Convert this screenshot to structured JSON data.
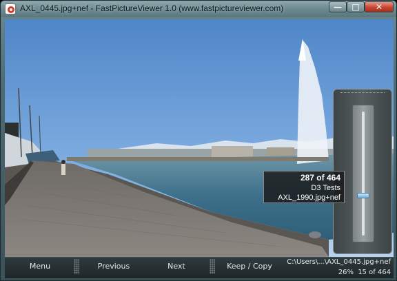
{
  "window": {
    "title": "AXL_0445.jpg+nef - FastPictureViewer 1.0 (www.fastpictureviewer.com)",
    "controls": {
      "minimize": "—",
      "maximize": "□",
      "close": "✕"
    }
  },
  "info": {
    "position": "287 of 464",
    "folder": "D3 Tests",
    "filename": "AXL_1990.jpg+nef"
  },
  "zoom_slider": {
    "level_fraction": 0.68
  },
  "toolbar": {
    "menu": "Menu",
    "previous": "Previous",
    "next": "Next",
    "keep_copy": "Keep / Copy"
  },
  "status": {
    "path": "C:\\Users\\...\\AXL_0445.jpg+nef",
    "zoom": "26%",
    "count": "15 of 464"
  },
  "colors": {
    "sky": "#6f9fd9",
    "lake": "#3a6f8c",
    "pavement": "#8a8480",
    "close_button": "#c7452f"
  }
}
